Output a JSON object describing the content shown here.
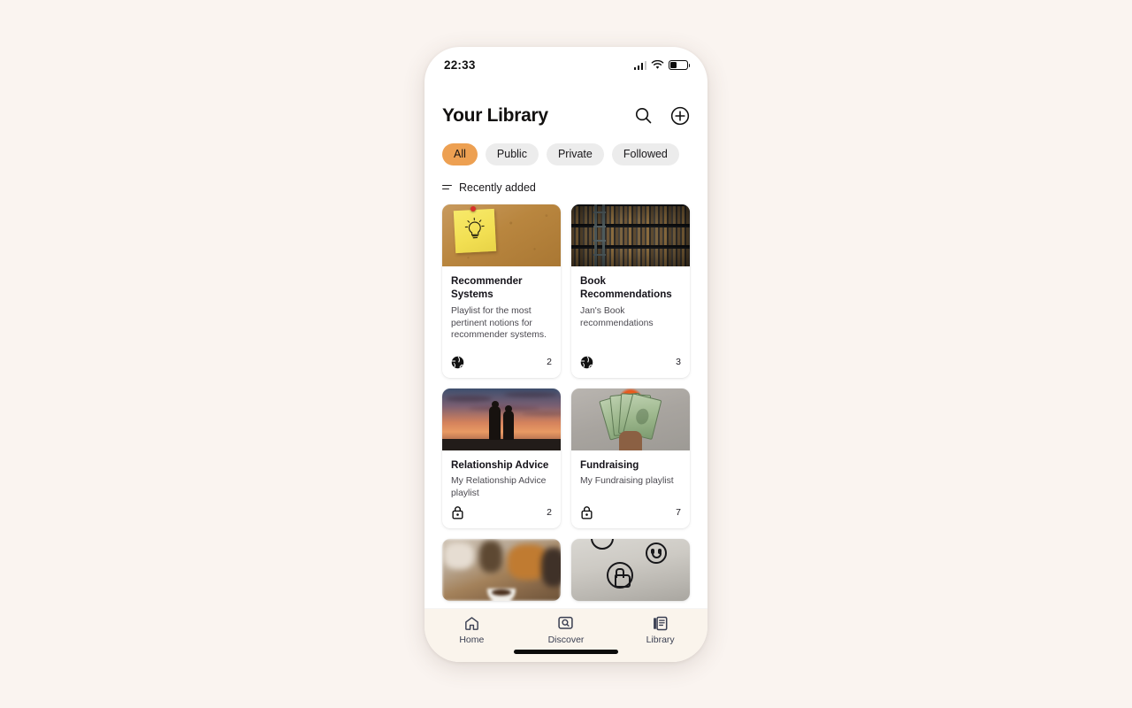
{
  "status_bar": {
    "time": "22:33",
    "signal_icon": "cellular-signal-icon",
    "wifi_icon": "wifi-icon",
    "battery_icon": "battery-icon",
    "battery_level_percent": 38
  },
  "header": {
    "title": "Your Library",
    "search_icon": "search-icon",
    "add_icon": "plus-circle-icon"
  },
  "filters": {
    "chips": [
      {
        "label": "All",
        "active": true
      },
      {
        "label": "Public",
        "active": false
      },
      {
        "label": "Private",
        "active": false
      },
      {
        "label": "Followed",
        "active": false
      }
    ],
    "active_chip_color": "#eda052",
    "inactive_chip_color": "#ececec"
  },
  "sort": {
    "icon": "sort-icon",
    "label": "Recently added"
  },
  "library": {
    "cards": [
      {
        "title": "Recommender Systems",
        "description": "Playlist for the most pertinent notions for recommender systems.",
        "visibility": "public",
        "visibility_icon": "globe-icon",
        "count": "2",
        "artwork": "cork-board-sticky-note-lightbulb"
      },
      {
        "title": "Book Recommendations",
        "description": "Jan's Book recommendations",
        "visibility": "public",
        "visibility_icon": "globe-icon",
        "count": "3",
        "artwork": "library-bookshelf-ladder"
      },
      {
        "title": "Relationship Advice",
        "description": "My Relationship Advice playlist",
        "visibility": "private",
        "visibility_icon": "lock-icon",
        "count": "2",
        "artwork": "sunset-couple-silhouette"
      },
      {
        "title": "Fundraising",
        "description": "My Fundraising playlist",
        "visibility": "private",
        "visibility_icon": "lock-icon",
        "count": "7",
        "artwork": "hand-holding-dollar-bills"
      },
      {
        "title": "",
        "description": "",
        "visibility": "",
        "visibility_icon": "",
        "count": "",
        "artwork": "blurred-coffee-shop-table"
      },
      {
        "title": "",
        "description": "",
        "visibility": "",
        "visibility_icon": "",
        "count": "",
        "artwork": "concrete-wall-smiley-thumbsup-graffiti"
      }
    ]
  },
  "bottom_nav": {
    "items": [
      {
        "label": "Home",
        "icon": "home-icon",
        "active": false
      },
      {
        "label": "Discover",
        "icon": "discover-search-icon",
        "active": false
      },
      {
        "label": "Library",
        "icon": "library-books-icon",
        "active": true
      }
    ],
    "background_color": "#faf4ec",
    "text_color": "#3a3f52"
  },
  "page": {
    "background_color": "#faf4f0",
    "phone_background_color": "#ffffff"
  }
}
